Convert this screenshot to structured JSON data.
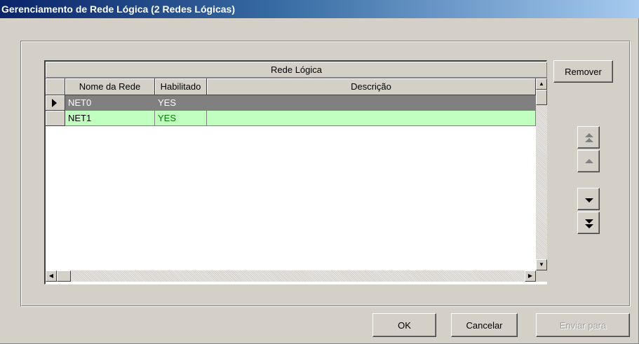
{
  "window": {
    "title": "Gerenciamento de Rede Lógica (2 Redes Lógicas)"
  },
  "grid": {
    "band_header": "Rede Lógica",
    "columns": [
      "Nome da Rede",
      "Habilitado",
      "Descrição"
    ],
    "rows": [
      {
        "name": "NET0",
        "enabled": "YES",
        "description": "",
        "selected": true,
        "bg": "#808080",
        "fg": "#ffffff",
        "enabled_fg": "#ffffff"
      },
      {
        "name": "NET1",
        "enabled": "YES",
        "description": "",
        "selected": false,
        "bg": "#c0ffc0",
        "fg": "#000000",
        "enabled_fg": "#008000"
      }
    ]
  },
  "buttons": {
    "remove": "Remover",
    "ok": "OK",
    "cancel": "Cancelar",
    "send_to": "Enviar para"
  },
  "nav_icons": [
    "move-top-icon",
    "move-up-icon",
    "move-down-icon",
    "move-bottom-icon"
  ],
  "colors": {
    "titlebar_start": "#0a246a",
    "titlebar_end": "#a6caf0",
    "window_bg": "#d4d0c8"
  }
}
